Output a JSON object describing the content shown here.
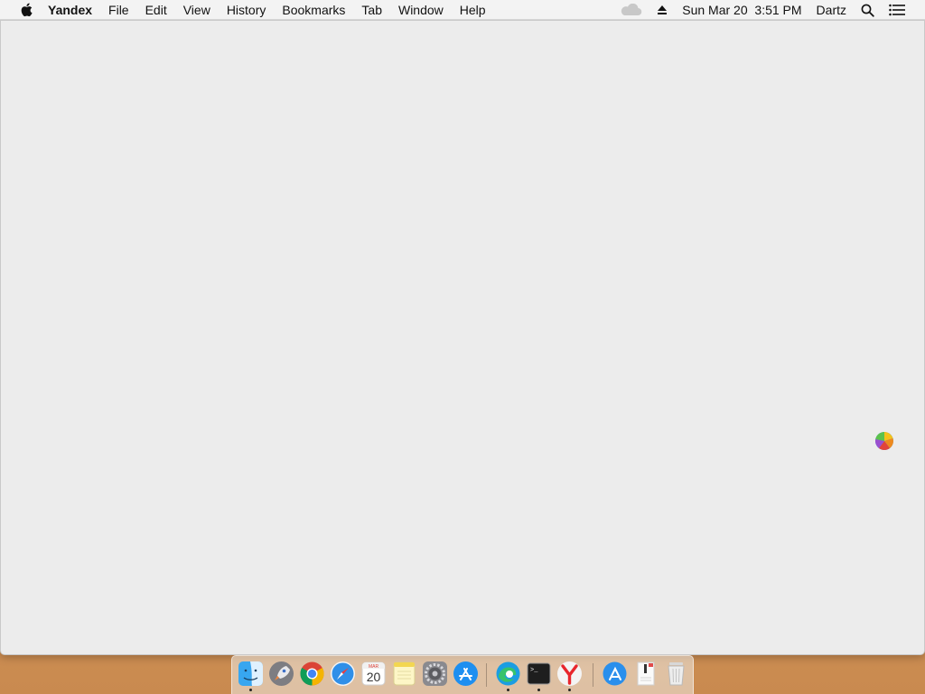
{
  "menubar": {
    "app_name": "Yandex",
    "items": [
      "File",
      "Edit",
      "View",
      "History",
      "Bookmarks",
      "Tab",
      "Window",
      "Help"
    ],
    "clock": "Sun Mar 20  3:51 PM",
    "user": "Dartz"
  },
  "dock": {
    "items": [
      {
        "name": "finder",
        "icon": "finder-icon",
        "running": true
      },
      {
        "name": "launchpad",
        "icon": "rocket-icon",
        "running": false
      },
      {
        "name": "chrome",
        "icon": "chrome-icon",
        "running": false
      },
      {
        "name": "safari",
        "icon": "compass-icon",
        "running": false
      },
      {
        "name": "calendar",
        "icon": "calendar-icon",
        "running": false,
        "month": "MAR",
        "day": "20"
      },
      {
        "name": "notes",
        "icon": "notes-icon",
        "running": false
      },
      {
        "name": "system-preferences",
        "icon": "gear-icon",
        "running": false
      },
      {
        "name": "app-store",
        "icon": "app-store-icon",
        "running": false
      },
      {
        "name": "edge",
        "icon": "edge-icon",
        "running": true
      },
      {
        "name": "terminal",
        "icon": "terminal-icon",
        "running": true,
        "prompt": ">_"
      },
      {
        "name": "yandex",
        "icon": "yandex-icon",
        "running": true
      },
      {
        "name": "downloads",
        "icon": "downloads-stack-icon",
        "running": false
      },
      {
        "name": "document",
        "icon": "document-stack-icon",
        "running": false
      },
      {
        "name": "trash",
        "icon": "trash-icon",
        "running": false
      }
    ]
  },
  "colors": {
    "menubar_bg": "#f3f3f3",
    "window_bg": "#ececec",
    "desktop": "#d69c61"
  }
}
